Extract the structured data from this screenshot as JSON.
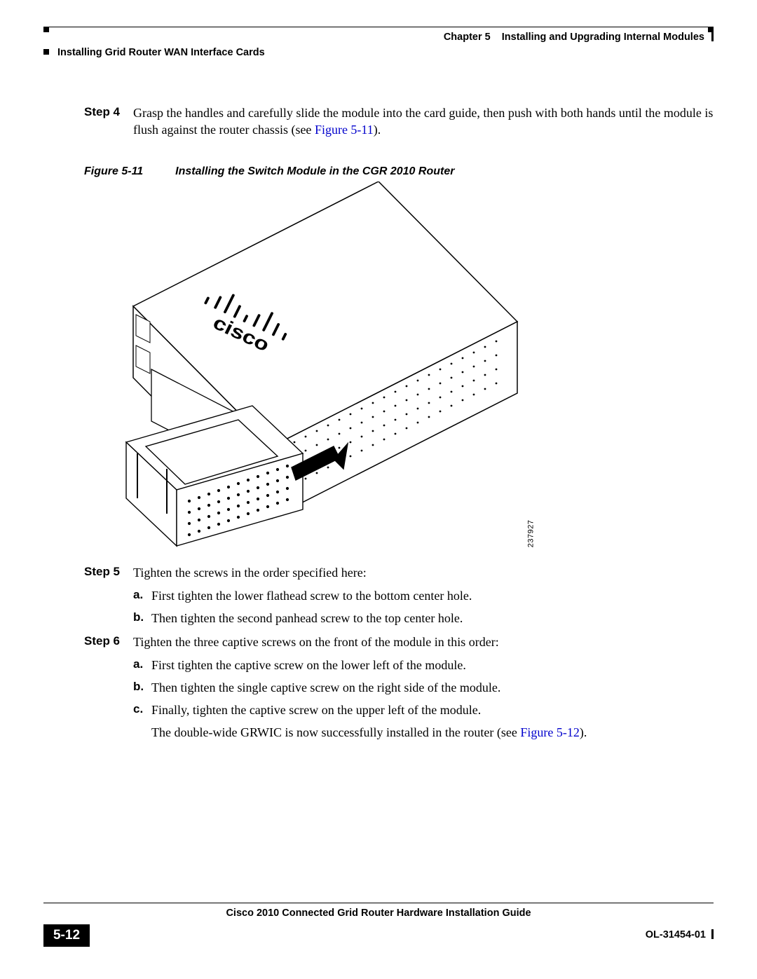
{
  "header": {
    "chapter_label": "Chapter 5",
    "chapter_title": "Installing and Upgrading Internal Modules",
    "section_title": "Installing Grid Router WAN Interface Cards"
  },
  "steps": {
    "step4": {
      "label": "Step 4",
      "text_a": "Grasp the handles and carefully slide the module into the card guide, then push with both hands until the module is flush against the router chassis (see ",
      "link": "Figure 5-11",
      "text_b": ")."
    },
    "step5": {
      "label": "Step 5",
      "intro": "Tighten the screws in the order specified here:",
      "a_marker": "a.",
      "a": "First tighten the lower flathead screw to the bottom center hole.",
      "b_marker": "b.",
      "b": "Then tighten the second panhead screw to the top center hole."
    },
    "step6": {
      "label": "Step 6",
      "intro": "Tighten the three captive screws on the front of the module in this order:",
      "a_marker": "a.",
      "a": "First tighten the captive screw on the lower left of the module.",
      "b_marker": "b.",
      "b": "Then tighten the single captive screw on the right side of the module.",
      "c_marker": "c.",
      "c": "Finally, tighten the captive screw on the upper left of the module.",
      "after_a": "The double-wide GRWIC is now successfully installed in the router (see ",
      "after_link": "Figure 5-12",
      "after_b": ")."
    }
  },
  "figure": {
    "number": "Figure 5-11",
    "title": "Installing the Switch Module in the CGR 2010 Router",
    "id": "237927",
    "logo": "cisco"
  },
  "footer": {
    "title": "Cisco 2010 Connected Grid Router Hardware Installation Guide",
    "page": "5-12",
    "doc_id": "OL-31454-01"
  }
}
